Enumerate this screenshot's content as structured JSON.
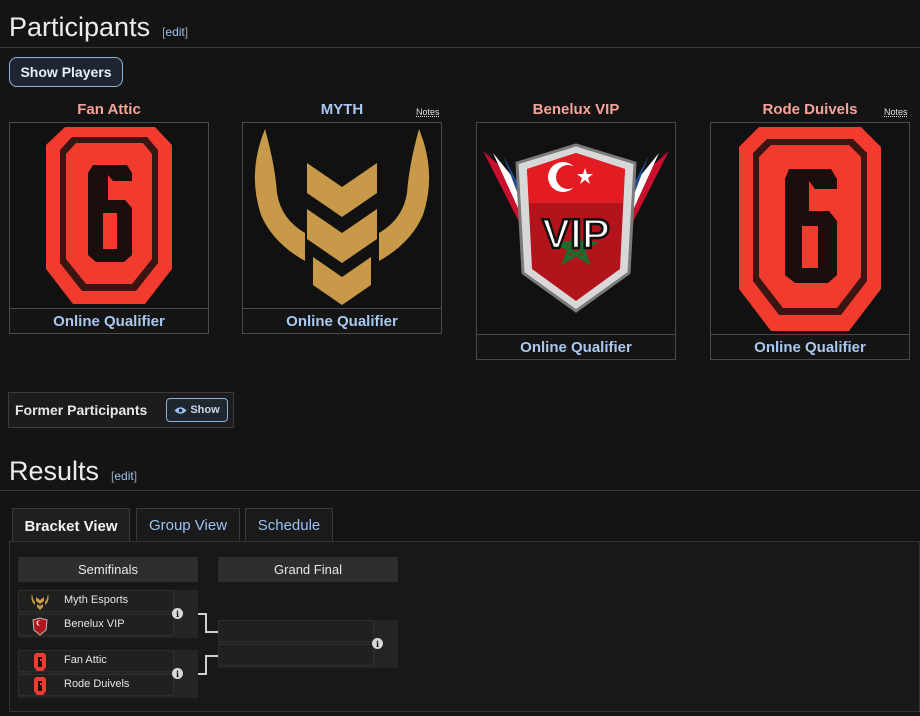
{
  "participants": {
    "heading": "Participants",
    "edit_label": "edit",
    "show_players_label": "Show Players",
    "teams": [
      {
        "name": "Fan Attic",
        "qualifier": "Online Qualifier",
        "logo": "rainbow-six-logo",
        "name_color": "#f5a49a"
      },
      {
        "name": "MYTH",
        "qualifier": "Online Qualifier",
        "logo": "myth-logo",
        "notes": "Notes",
        "name_color": "#a8c8f0"
      },
      {
        "name": "Benelux VIP",
        "qualifier": "Online Qualifier",
        "logo": "benelux-vip-logo",
        "name_color": "#f5a49a"
      },
      {
        "name": "Rode Duivels",
        "qualifier": "Online Qualifier",
        "logo": "rainbow-six-logo",
        "notes": "Notes",
        "name_color": "#f5a49a"
      }
    ],
    "former_label": "Former Participants",
    "former_show_label": "Show"
  },
  "results": {
    "heading": "Results",
    "edit_label": "edit",
    "tabs": [
      {
        "label": "Bracket View",
        "active": true
      },
      {
        "label": "Group View",
        "active": false
      },
      {
        "label": "Schedule",
        "active": false
      }
    ],
    "rounds": [
      "Semifinals",
      "Grand Final"
    ],
    "semifinals": [
      {
        "team1": "Myth Esports",
        "team2": "Benelux VIP"
      },
      {
        "team1": "Fan Attic",
        "team2": "Rode Duivels"
      }
    ],
    "info_symbol": "i"
  },
  "colors": {
    "background": "#141414",
    "link": "#a8c8f0",
    "team_red": "#f5a49a",
    "r6_red": "#f13b2e",
    "myth_gold": "#c9994a"
  }
}
